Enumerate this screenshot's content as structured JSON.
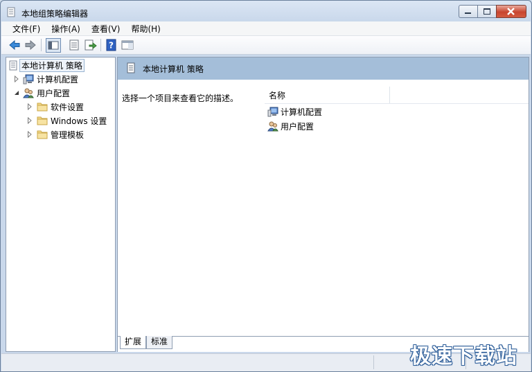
{
  "window": {
    "title": "本地组策略编辑器"
  },
  "menu": [
    {
      "label": "文件(F)"
    },
    {
      "label": "操作(A)"
    },
    {
      "label": "查看(V)"
    },
    {
      "label": "帮助(H)"
    }
  ],
  "toolbar": {
    "icons": [
      "back-arrow-icon",
      "forward-arrow-icon",
      "show-tree-icon",
      "properties-icon",
      "export-list-icon",
      "help-icon",
      "action-pane-icon"
    ]
  },
  "tree": {
    "root": "本地计算机 策略",
    "computer_config": "计算机配置",
    "user_config": "用户配置",
    "software_settings": "软件设置",
    "windows_settings": "Windows 设置",
    "admin_templates": "管理模板"
  },
  "right": {
    "header_title": "本地计算机 策略",
    "description": "选择一个项目来查看它的描述。",
    "column_name": "名称",
    "rows": [
      "计算机配置",
      "用户配置"
    ]
  },
  "tabs": {
    "extended": "扩展",
    "standard": "标准"
  },
  "watermark": "极速下载站",
  "colors": {
    "header_band": "#a4bed9",
    "folder": "#f2d98b",
    "close_button": "#c8452f"
  }
}
